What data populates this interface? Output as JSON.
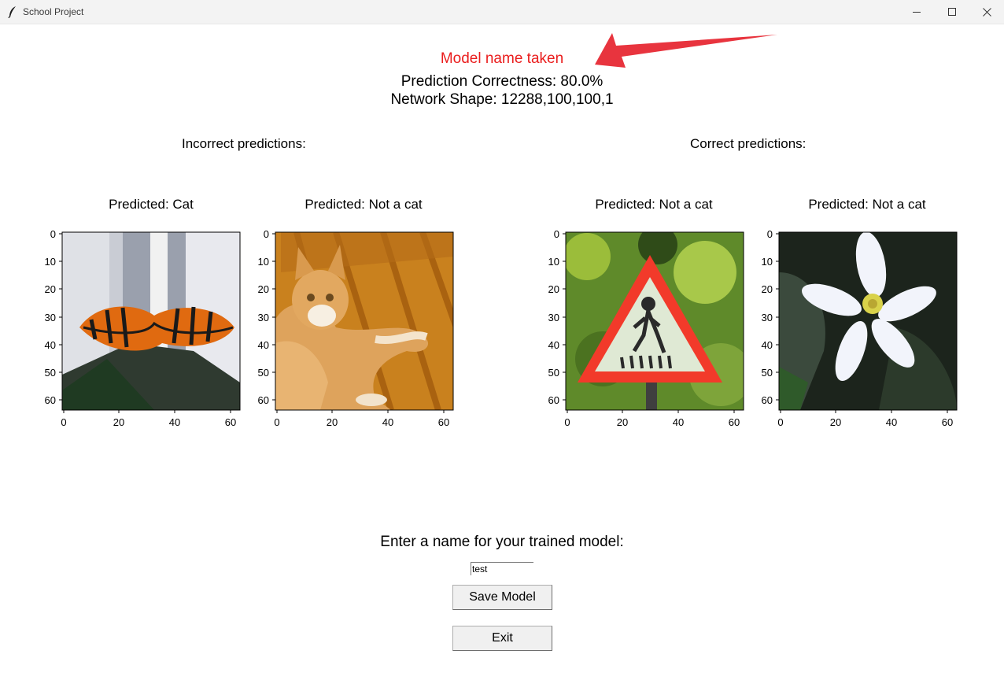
{
  "window": {
    "title": "School Project",
    "app_icon": "feather-icon",
    "controls": [
      "minimize-icon",
      "maximize-icon",
      "close-icon"
    ]
  },
  "header": {
    "status_message": "Model name taken",
    "status_color": "#ea1d1d",
    "correctness": "Prediction Correctness: 80.0%",
    "network_shape": "Network Shape: 12288,100,100,1"
  },
  "annotation": {
    "arrow_color": "#e8343e",
    "icon": "arrow-annotation"
  },
  "sections": {
    "incorrect_label": "Incorrect predictions:",
    "correct_label": "Correct predictions:"
  },
  "plots": [
    {
      "title": "Predicted: Cat",
      "image": "butterfly",
      "group": "incorrect"
    },
    {
      "title": "Predicted: Not a cat",
      "image": "cat",
      "group": "incorrect"
    },
    {
      "title": "Predicted: Not a cat",
      "image": "warning-sign",
      "group": "correct"
    },
    {
      "title": "Predicted: Not a cat",
      "image": "flower",
      "group": "correct"
    }
  ],
  "axes": {
    "y_ticks": [
      "0",
      "10",
      "20",
      "30",
      "40",
      "50",
      "60"
    ],
    "x_ticks": [
      "0",
      "20",
      "40",
      "60"
    ]
  },
  "save_form": {
    "prompt": "Enter a name for your trained model:",
    "input_value": "test",
    "save_label": "Save Model",
    "exit_label": "Exit"
  }
}
